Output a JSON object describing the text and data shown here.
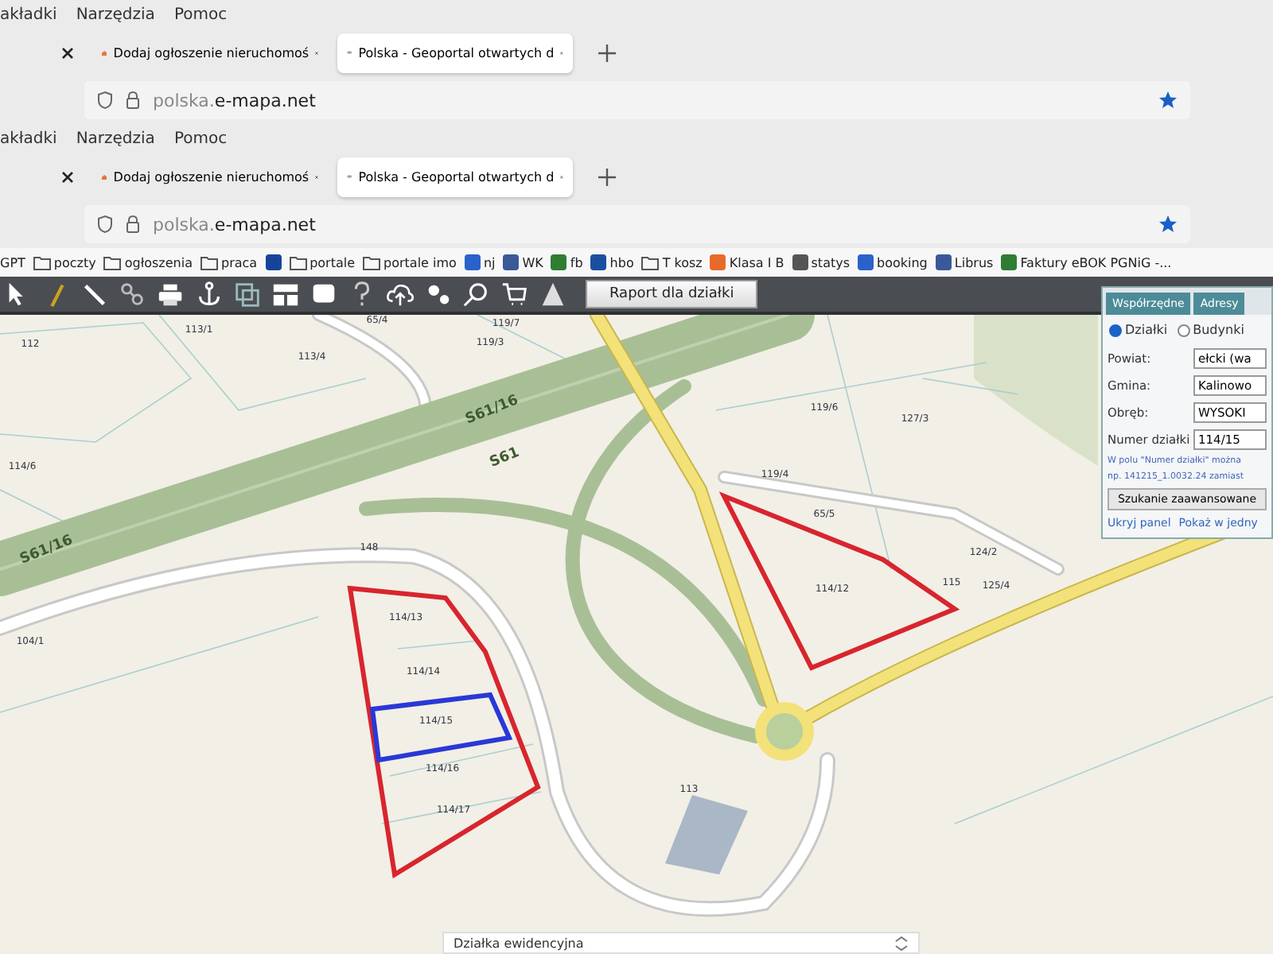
{
  "browser_windows": [
    {
      "menu": [
        "akładki",
        "Narzędzia",
        "Pomoc"
      ],
      "tabs": [
        {
          "kind": "blank",
          "selected": false
        },
        {
          "kind": "house",
          "title": "Dodaj ogłoszenie nieruchomoś",
          "selected": false
        },
        {
          "kind": "globe",
          "title": "Polska - Geoportal otwartych d",
          "selected": true
        }
      ],
      "url_prefix": "polska.",
      "url_domain": "e-mapa.net",
      "bookmarked": true
    },
    {
      "menu": [
        "akładki",
        "Narzędzia",
        "Pomoc"
      ],
      "tabs": [
        {
          "kind": "blank",
          "selected": false
        },
        {
          "kind": "house",
          "title": "Dodaj ogłoszenie nieruchomoś",
          "selected": false
        },
        {
          "kind": "globe",
          "title": "Polska - Geoportal otwartych d",
          "selected": true
        }
      ],
      "url_prefix": "polska.",
      "url_domain": "e-mapa.net",
      "bookmarked": true
    }
  ],
  "bookmarks": [
    {
      "kind": "plain",
      "label": "GPT"
    },
    {
      "kind": "folder",
      "label": "poczty"
    },
    {
      "kind": "folder",
      "label": "ogłoszenia"
    },
    {
      "kind": "folder",
      "label": "praca"
    },
    {
      "kind": "site"
    },
    {
      "kind": "folder",
      "label": "portale"
    },
    {
      "kind": "folder",
      "label": "portale imo"
    },
    {
      "kind": "site",
      "label": "nj"
    },
    {
      "kind": "site",
      "label": "WK"
    },
    {
      "kind": "site",
      "label": "fb"
    },
    {
      "kind": "site",
      "label": "hbo"
    },
    {
      "kind": "folder",
      "label": "T kosz"
    },
    {
      "kind": "site",
      "label": "Klasa I B"
    },
    {
      "kind": "site",
      "label": "statys"
    },
    {
      "kind": "site",
      "label": "booking"
    },
    {
      "kind": "site",
      "label": "Librus"
    },
    {
      "kind": "site",
      "label": "Faktury eBOK PGNiG -..."
    }
  ],
  "toolbar": {
    "report_button": "Raport dla działki"
  },
  "map": {
    "parcel_labels": [
      "112",
      "113/1",
      "65/4",
      "119/7",
      "119/3",
      "113/4",
      "114/6",
      "119/6",
      "127/3",
      "119/4",
      "65/5",
      "114/12",
      "124/2",
      "115",
      "125/4",
      "148",
      "104/1",
      "114/13",
      "114/14",
      "114/15",
      "114/16",
      "114/17",
      "113"
    ],
    "road_labels": [
      "S61/16",
      "S61",
      "S61/16"
    ],
    "legend_title": "Działka ewidencyjna"
  },
  "search_panel": {
    "tabs": [
      {
        "label": "Współrzędne",
        "selected": false
      },
      {
        "label": "Adresy",
        "selected": false
      }
    ],
    "options": [
      {
        "label": "Działki",
        "selected": true
      },
      {
        "label": "Budynki",
        "selected": false
      }
    ],
    "fields": [
      {
        "label": "Powiat:",
        "value": "ełcki (wa"
      },
      {
        "label": "Gmina:",
        "value": "Kalinowo"
      },
      {
        "label": "Obręb:",
        "value": "WYSOKI"
      },
      {
        "label": "Numer działki",
        "value": "114/15"
      }
    ],
    "hint": [
      "W polu \"Numer działki\" można",
      "np. 141215_1.0032.24 zamiast"
    ],
    "advanced_button": "Szukanie zaawansowane",
    "links": [
      "Ukryj panel",
      "Pokaż w jedny"
    ]
  }
}
